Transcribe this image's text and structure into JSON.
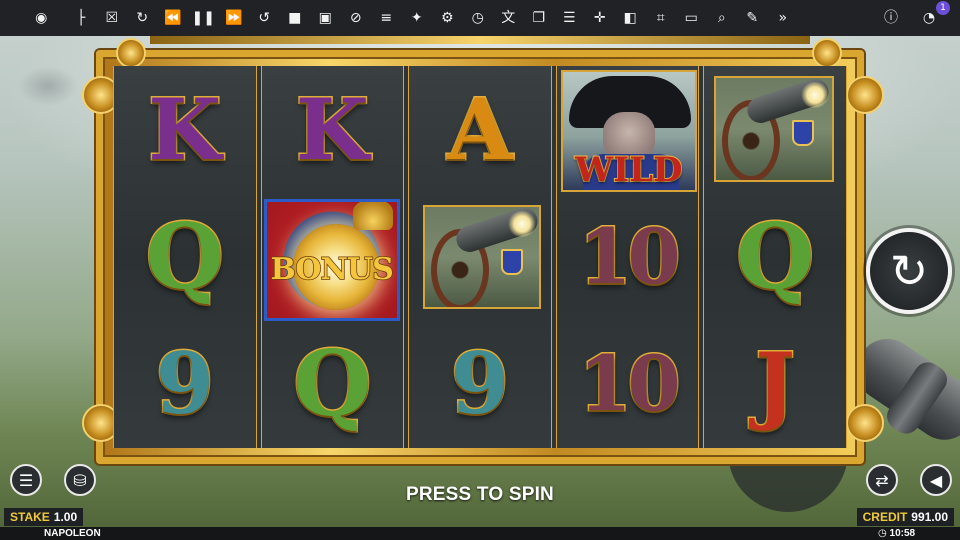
{
  "toolbar": {
    "left_icons": [
      "eye-off-icon"
    ],
    "center_icons": [
      "tree-icon",
      "trash-icon",
      "refresh-icon",
      "rewind-icon",
      "pause-icon",
      "fast-forward-icon",
      "replay-icon",
      "stop-icon",
      "movie-icon",
      "ad-block-icon",
      "playlist-icon",
      "gamepad-icon",
      "settings-timer-icon",
      "stopwatch-icon",
      "translate-icon",
      "copy-icon",
      "list-icon",
      "move-icon",
      "flip-icon",
      "crop-icon",
      "terminal-icon",
      "search-icon",
      "edit-icon",
      "skip-icon"
    ],
    "right_icons": [
      "info-icon",
      "speed-icon"
    ],
    "notification_count": "1"
  },
  "reels": [
    [
      "K",
      "Q",
      "9"
    ],
    [
      "K",
      "BONUS",
      "Q"
    ],
    [
      "A",
      "cannon",
      "9"
    ],
    [
      "WILD",
      "10",
      "10"
    ],
    [
      "cannon",
      "Q",
      "J"
    ]
  ],
  "symbols": {
    "wild_label": "WILD",
    "bonus_label": "BONUS"
  },
  "controls": {
    "press_to_spin": "PRESS TO SPIN",
    "stake_label": "STAKE",
    "stake_value": "1.00",
    "credit_label": "CREDIT",
    "credit_value": "991.00",
    "game_name": "NAPOLEON",
    "time": "10:58"
  },
  "colors": {
    "gold": "#d9a62f",
    "label_yellow": "#f0c93a",
    "toolbar_bg": "#202225"
  }
}
